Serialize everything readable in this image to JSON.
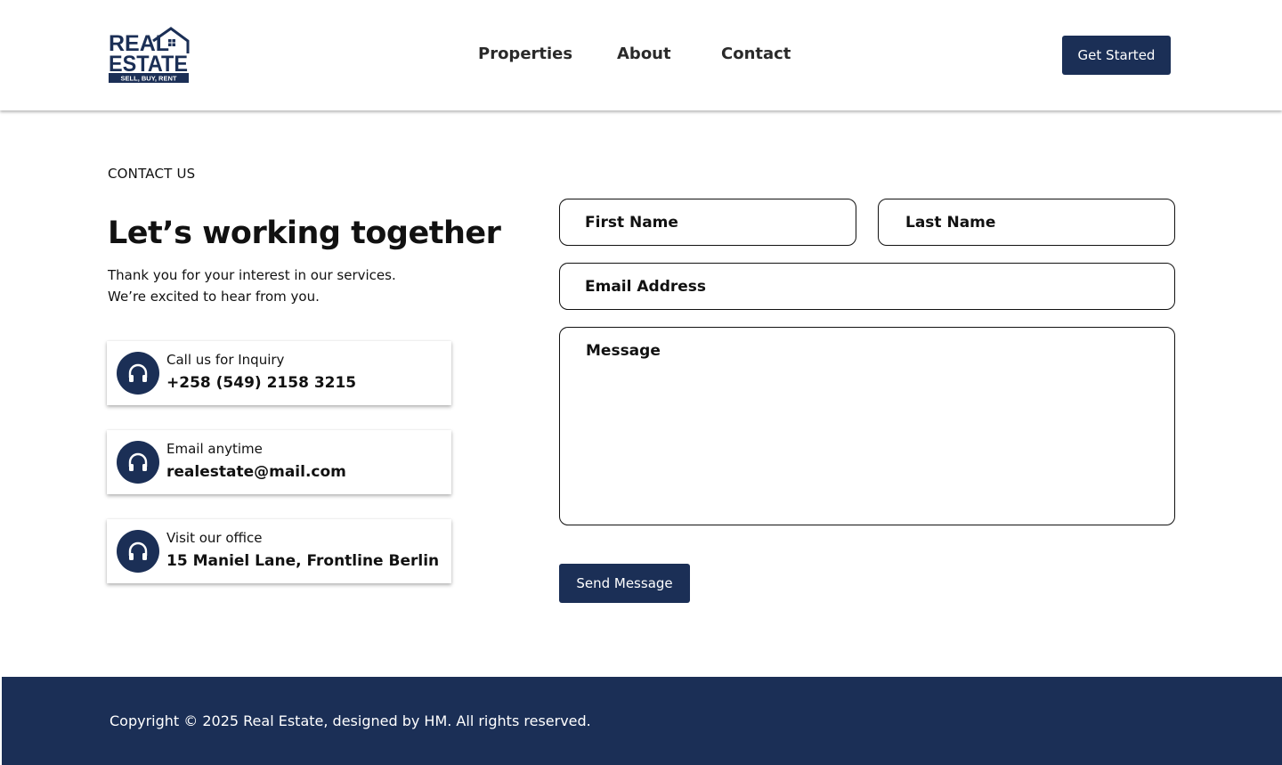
{
  "brand": {
    "logo_line1": "REAL",
    "logo_line2": "ESTATE",
    "logo_tagline": "SELL, BUY, RENT",
    "color": "#1b2f56"
  },
  "nav": {
    "items": [
      {
        "label": "Properties"
      },
      {
        "label": "About"
      },
      {
        "label": "Contact"
      }
    ],
    "cta_label": "Get Started"
  },
  "contact": {
    "eyebrow": "CONTACT US",
    "headline": "Let’s working together",
    "intro_line1": "Thank you for your interest in our services.",
    "intro_line2": "We’re excited to hear from you.",
    "cards": [
      {
        "icon": "headphones-icon",
        "label": "Call us for Inquiry",
        "value": "+258 (549) 2158 3215"
      },
      {
        "icon": "headphones-icon",
        "label": "Email anytime",
        "value": "realestate@mail.com"
      },
      {
        "icon": "headphones-icon",
        "label": "Visit our office",
        "value": "15 Maniel Lane, Frontline Berlin"
      }
    ]
  },
  "form": {
    "first_name_placeholder": "First Name",
    "last_name_placeholder": "Last Name",
    "email_placeholder": "Email Address",
    "message_placeholder": "Message",
    "submit_label": "Send Message"
  },
  "footer": {
    "copyright": "Copyright © 2025 Real Estate, designed by HM. All rights reserved."
  }
}
